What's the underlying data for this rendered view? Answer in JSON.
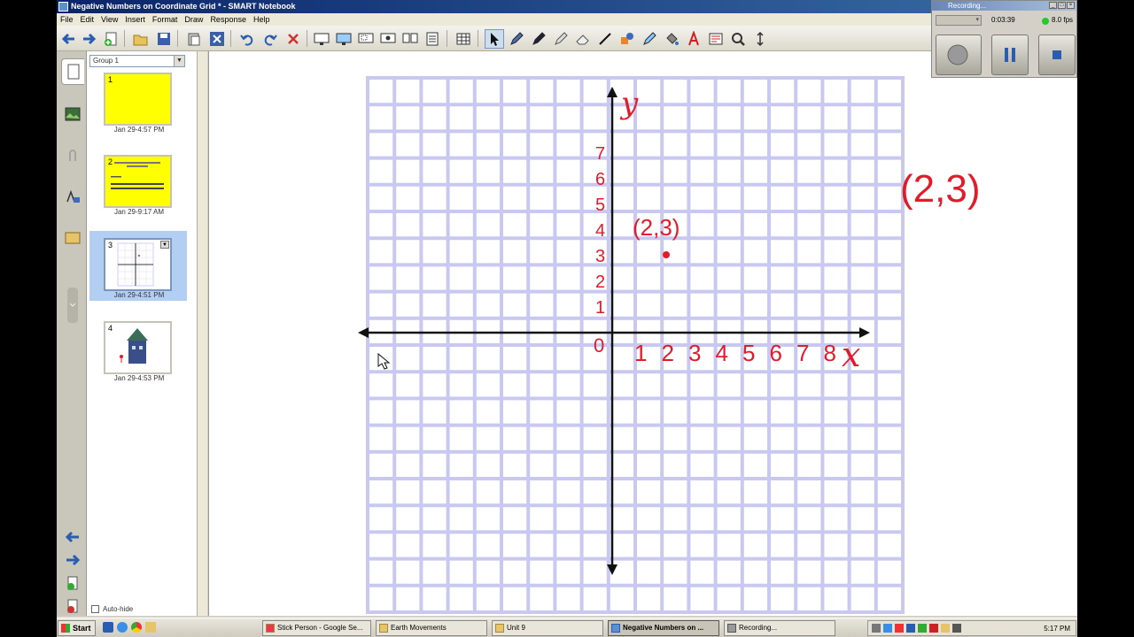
{
  "window": {
    "title": "Negative Numbers on Coordinate Grid * - SMART Notebook"
  },
  "menu": [
    "File",
    "Edit",
    "View",
    "Insert",
    "Format",
    "Draw",
    "Response",
    "Help"
  ],
  "sorter": {
    "group": "Group 1",
    "pages": [
      {
        "number": "1",
        "label": "Jan 29-4:57 PM"
      },
      {
        "number": "2",
        "label": "Jan 29-9:17 AM"
      },
      {
        "number": "3",
        "label": "Jan 29-4:51 PM"
      },
      {
        "number": "4",
        "label": "Jan 29-4:53 PM"
      }
    ],
    "auto_hide": "Auto-hide"
  },
  "canvas": {
    "y_axis_label": "y",
    "x_axis_label": "x",
    "origin": "0",
    "y_ticks": [
      "1",
      "2",
      "3",
      "4",
      "5",
      "6",
      "7"
    ],
    "x_ticks": [
      "1",
      "2",
      "3",
      "4",
      "5",
      "6",
      "7",
      "8"
    ],
    "point_label": "(2,3)",
    "side_note": "(2,3)",
    "grid_color": "#c8c8f0",
    "ink_color": "#e21b2b"
  },
  "recorder": {
    "title": "Recording...",
    "time": "0:03:39",
    "fps": "8.0 fps"
  },
  "taskbar": {
    "start": "Start",
    "tasks": [
      "Stick Person - Google Se...",
      "Earth Movements",
      "Unit 9",
      "Negative Numbers on ...",
      "Recording..."
    ],
    "clock": "5:17 PM"
  }
}
